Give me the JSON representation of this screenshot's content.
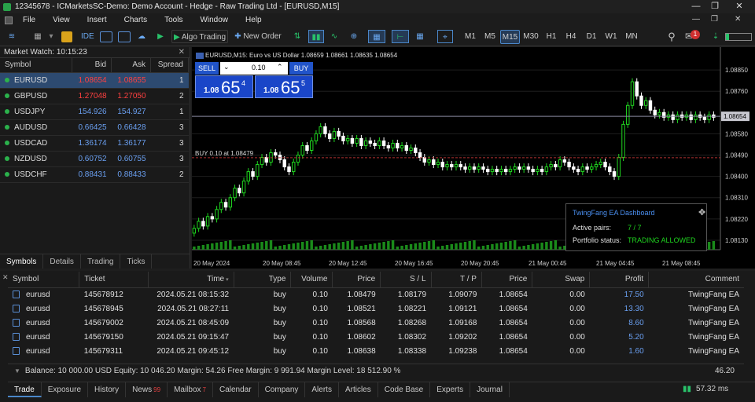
{
  "titlebar": {
    "title": "12345678 - ICMarketsSC-Demo: Demo Account - Hedge - Raw Trading Ltd - [EURUSD,M15]"
  },
  "menu": {
    "items": [
      "File",
      "View",
      "Insert",
      "Charts",
      "Tools",
      "Window",
      "Help"
    ]
  },
  "toolbar": {
    "algo_label": "Algo Trading",
    "new_order_label": "New Order",
    "timeframes": [
      "M1",
      "M5",
      "M15",
      "M30",
      "H1",
      "H4",
      "D1",
      "W1",
      "MN"
    ],
    "active_tf": "M15",
    "notif_count": "1"
  },
  "market_watch": {
    "title": "Market Watch: 10:15:23",
    "columns": [
      "Symbol",
      "Bid",
      "Ask",
      "Spread"
    ],
    "rows": [
      {
        "symbol": "EURUSD",
        "bid": "1.08654",
        "ask": "1.08655",
        "spread": "1",
        "dir": "down"
      },
      {
        "symbol": "GBPUSD",
        "bid": "1.27048",
        "ask": "1.27050",
        "spread": "2",
        "dir": "down"
      },
      {
        "symbol": "USDJPY",
        "bid": "154.926",
        "ask": "154.927",
        "spread": "1",
        "dir": "up"
      },
      {
        "symbol": "AUDUSD",
        "bid": "0.66425",
        "ask": "0.66428",
        "spread": "3",
        "dir": "up"
      },
      {
        "symbol": "USDCAD",
        "bid": "1.36174",
        "ask": "1.36177",
        "spread": "3",
        "dir": "up"
      },
      {
        "symbol": "NZDUSD",
        "bid": "0.60752",
        "ask": "0.60755",
        "spread": "3",
        "dir": "up"
      },
      {
        "symbol": "USDCHF",
        "bid": "0.88431",
        "ask": "0.88433",
        "spread": "2",
        "dir": "up"
      }
    ],
    "tabs": [
      "Symbols",
      "Details",
      "Trading",
      "Ticks"
    ]
  },
  "chart": {
    "header": "EURUSD,M15:  Euro vs US Dollar  1.08659 1.08661 1.08635 1.08654",
    "sell_label": "SELL",
    "buy_label": "BUY",
    "lot": "0.10",
    "sell_price_small": "1.08",
    "sell_price_big": "65",
    "sell_price_sup": "4",
    "buy_price_small": "1.08",
    "buy_price_big": "65",
    "buy_price_sup": "5",
    "buy_line_label": "BUY 0.10 at 1.08479",
    "current_price_label": "1.08654",
    "y_ticks": [
      "1.08850",
      "1.08760",
      "1.08580",
      "1.08490",
      "1.08400",
      "1.08310",
      "1.08220",
      "1.08130"
    ],
    "x_ticks": [
      "20 May 2024",
      "20 May 08:45",
      "20 May 12:45",
      "20 May 16:45",
      "20 May 20:45",
      "21 May 00:45",
      "21 May 04:45",
      "21 May 08:45"
    ],
    "colors": {
      "up": "#1fd51f",
      "down": "#ffffff",
      "bg": "#000000",
      "grid": "#1e1e1e",
      "buy_line": "#b03030"
    }
  },
  "chart_data": {
    "type": "candlestick",
    "symbol": "EURUSD",
    "timeframe": "M15",
    "ylim": [
      1.0809,
      1.0892
    ],
    "y_ticks": [
      1.0885,
      1.0876,
      1.0858,
      1.0849,
      1.084,
      1.0831,
      1.0822,
      1.0813
    ],
    "buy_line": 1.08479,
    "current_price": 1.08654,
    "closes": [
      1.0818,
      1.0821,
      1.0819,
      1.0823,
      1.0822,
      1.0826,
      1.0829,
      1.0827,
      1.0831,
      1.0835,
      1.0833,
      1.0838,
      1.0842,
      1.084,
      1.0845,
      1.0848,
      1.0846,
      1.085,
      1.0849,
      1.0847,
      1.0844,
      1.0842,
      1.0846,
      1.0849,
      1.0853,
      1.0851,
      1.0855,
      1.0858,
      1.0861,
      1.0858,
      1.0856,
      1.0859,
      1.0857,
      1.0855,
      1.0856,
      1.0854,
      1.0856,
      1.0853,
      1.0855,
      1.0854,
      1.0853,
      1.0855,
      1.0853,
      1.0852,
      1.0854,
      1.0852,
      1.0853,
      1.0851,
      1.0852,
      1.085,
      1.0848,
      1.0846,
      1.0847,
      1.0845,
      1.0846,
      1.0844,
      1.0845,
      1.0844,
      1.0845,
      1.0844,
      1.0843,
      1.0844,
      1.0843,
      1.0844,
      1.0843,
      1.0842,
      1.0843,
      1.0842,
      1.0843,
      1.0842,
      1.0843,
      1.0844,
      1.0843,
      1.0844,
      1.0843,
      1.0842,
      1.0843,
      1.0842,
      1.0844,
      1.0845,
      1.0844,
      1.0847,
      1.0846,
      1.0844,
      1.0843,
      1.0842,
      1.0844,
      1.0843,
      1.0844,
      1.0845,
      1.0846,
      1.0844,
      1.0842,
      1.084,
      1.0848,
      1.0862,
      1.087,
      1.088,
      1.0874,
      1.087,
      1.0872,
      1.0868,
      1.0866,
      1.0867,
      1.0865,
      1.0866,
      1.0864,
      1.0866,
      1.0865,
      1.0866,
      1.0864,
      1.0866,
      1.0865,
      1.0864,
      1.0866,
      1.0865
    ]
  },
  "dashboard": {
    "title": "TwingFang EA Dashboard",
    "pairs_label": "Active pairs:",
    "pairs_value": "7 / 7",
    "status_label": "Portfolio status:",
    "status_value": "TRADING ALLOWED"
  },
  "trades": {
    "columns": [
      "Symbol",
      "Ticket",
      "Time",
      "Type",
      "Volume",
      "Price",
      "S / L",
      "T / P",
      "Price",
      "Swap",
      "Profit",
      "Comment"
    ],
    "rows": [
      {
        "symbol": "eurusd",
        "ticket": "145678912",
        "time": "2024.05.21 08:15:32",
        "type": "buy",
        "volume": "0.10",
        "price": "1.08479",
        "sl": "1.08179",
        "tp": "1.09079",
        "cur": "1.08654",
        "swap": "0.00",
        "profit": "17.50",
        "comment": "TwingFang EA"
      },
      {
        "symbol": "eurusd",
        "ticket": "145678945",
        "time": "2024.05.21 08:27:11",
        "type": "buy",
        "volume": "0.10",
        "price": "1.08521",
        "sl": "1.08221",
        "tp": "1.09121",
        "cur": "1.08654",
        "swap": "0.00",
        "profit": "13.30",
        "comment": "TwingFang EA"
      },
      {
        "symbol": "eurusd",
        "ticket": "145679002",
        "time": "2024.05.21 08:45:09",
        "type": "buy",
        "volume": "0.10",
        "price": "1.08568",
        "sl": "1.08268",
        "tp": "1.09168",
        "cur": "1.08654",
        "swap": "0.00",
        "profit": "8.60",
        "comment": "TwingFang EA"
      },
      {
        "symbol": "eurusd",
        "ticket": "145679150",
        "time": "2024.05.21 09:15:47",
        "type": "buy",
        "volume": "0.10",
        "price": "1.08602",
        "sl": "1.08302",
        "tp": "1.09202",
        "cur": "1.08654",
        "swap": "0.00",
        "profit": "5.20",
        "comment": "TwingFang EA"
      },
      {
        "symbol": "eurusd",
        "ticket": "145679311",
        "time": "2024.05.21 09:45:12",
        "type": "buy",
        "volume": "0.10",
        "price": "1.08638",
        "sl": "1.08338",
        "tp": "1.09238",
        "cur": "1.08654",
        "swap": "0.00",
        "profit": "1.60",
        "comment": "TwingFang EA"
      }
    ],
    "balance_line": "Balance: 10 000.00 USD   Equity: 10 046.20   Margin: 54.26   Free Margin: 9 991.94   Margin Level: 18 512.90 %",
    "total_profit": "46.20"
  },
  "bottom_tabs": [
    {
      "label": "Trade"
    },
    {
      "label": "Exposure"
    },
    {
      "label": "History"
    },
    {
      "label": "News",
      "badge": "99"
    },
    {
      "label": "Mailbox",
      "badge": "7"
    },
    {
      "label": "Calendar"
    },
    {
      "label": "Company"
    },
    {
      "label": "Alerts"
    },
    {
      "label": "Articles"
    },
    {
      "label": "Code Base"
    },
    {
      "label": "Experts"
    },
    {
      "label": "Journal"
    }
  ],
  "status": {
    "ping": "57.32 ms"
  }
}
